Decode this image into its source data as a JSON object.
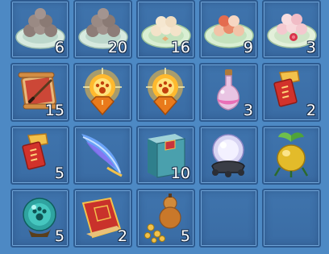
{
  "inventory": {
    "slots": [
      {
        "item": "plate-of-gray-dumplings",
        "count": "6"
      },
      {
        "item": "plate-of-gray-dumplings",
        "count": "20"
      },
      {
        "item": "plate-of-sesame-dumplings",
        "count": "16"
      },
      {
        "item": "plate-of-red-dumplings",
        "count": "9"
      },
      {
        "item": "plate-of-rose-dumplings",
        "count": "3"
      },
      {
        "item": "scroll-with-brush",
        "count": "15"
      },
      {
        "item": "glowing-paw-crystal",
        "count": ""
      },
      {
        "item": "glowing-paw-crystal",
        "count": ""
      },
      {
        "item": "pink-potion-bottle",
        "count": "3"
      },
      {
        "item": "red-talisman-charm",
        "count": "2"
      },
      {
        "item": "red-talisman-charm",
        "count": "5"
      },
      {
        "item": "blue-feather",
        "count": ""
      },
      {
        "item": "blue-book",
        "count": "10"
      },
      {
        "item": "crystal-ball-on-stand",
        "count": ""
      },
      {
        "item": "golden-fruit",
        "count": ""
      },
      {
        "item": "green-paw-orb",
        "count": "5"
      },
      {
        "item": "red-envelope-book",
        "count": "2"
      },
      {
        "item": "gourd-with-coins",
        "count": "5"
      },
      {
        "item": "empty-slot",
        "count": ""
      },
      {
        "item": "empty-slot",
        "count": ""
      }
    ]
  }
}
